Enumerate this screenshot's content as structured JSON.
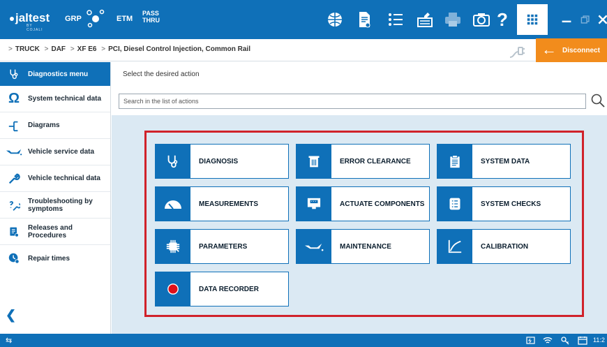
{
  "topbar": {
    "logo": "jaltest",
    "logo_sub": "BY COJALI",
    "grp": "GRP",
    "etm": "ETM",
    "pass_thru": "PASS\nTHRU",
    "icons": [
      "globe-icon",
      "document-icon",
      "list-icon",
      "clipboard-icon",
      "printer-icon",
      "camera-icon",
      "help-icon",
      "apps-grid-icon",
      "minimize-icon",
      "restore-icon",
      "close-icon"
    ],
    "help_label": "?"
  },
  "breadcrumb": {
    "items": [
      "TRUCK",
      "DAF",
      "XF E6",
      "PCI, Diesel Control Injection, Common Rail"
    ]
  },
  "disconnect": {
    "label": "Disconnect",
    "color": "#f28c1c"
  },
  "sidebar": {
    "header": "Diagnostics menu",
    "items": [
      {
        "label": "System technical data",
        "icon": "omega-icon"
      },
      {
        "label": "Diagrams",
        "icon": "diagram-icon"
      },
      {
        "label": "Vehicle service data",
        "icon": "oil-can-icon"
      },
      {
        "label": "Vehicle technical data",
        "icon": "wrench-icon"
      },
      {
        "label": "Troubleshooting by symptoms",
        "icon": "troubleshoot-icon"
      },
      {
        "label": "Releases and Procedures",
        "icon": "procedures-icon"
      },
      {
        "label": "Repair times",
        "icon": "repair-times-icon"
      }
    ]
  },
  "main": {
    "instruction": "Select the desired action",
    "search_placeholder": "Search in the list of actions"
  },
  "actions": [
    {
      "label": "DIAGNOSIS",
      "icon": "stethoscope-icon"
    },
    {
      "label": "ERROR CLEARANCE",
      "icon": "trash-icon"
    },
    {
      "label": "SYSTEM DATA",
      "icon": "clipboard-icon"
    },
    {
      "label": "MEASUREMENTS",
      "icon": "gauge-icon"
    },
    {
      "label": "ACTUATE COMPONENTS",
      "icon": "monitor-icon"
    },
    {
      "label": "SYSTEM CHECKS",
      "icon": "checklist-icon"
    },
    {
      "label": "PARAMETERS",
      "icon": "chip-icon"
    },
    {
      "label": "MAINTENANCE",
      "icon": "oil-can-icon"
    },
    {
      "label": "CALIBRATION",
      "icon": "calibration-curve-icon"
    },
    {
      "label": "DATA RECORDER",
      "icon": "record-icon"
    }
  ],
  "status": {
    "time": "11:2"
  },
  "colors": {
    "primary": "#0f70b8",
    "accent": "#f28c1c",
    "highlight": "#d0222a",
    "content_bg": "#dbe9f3"
  }
}
